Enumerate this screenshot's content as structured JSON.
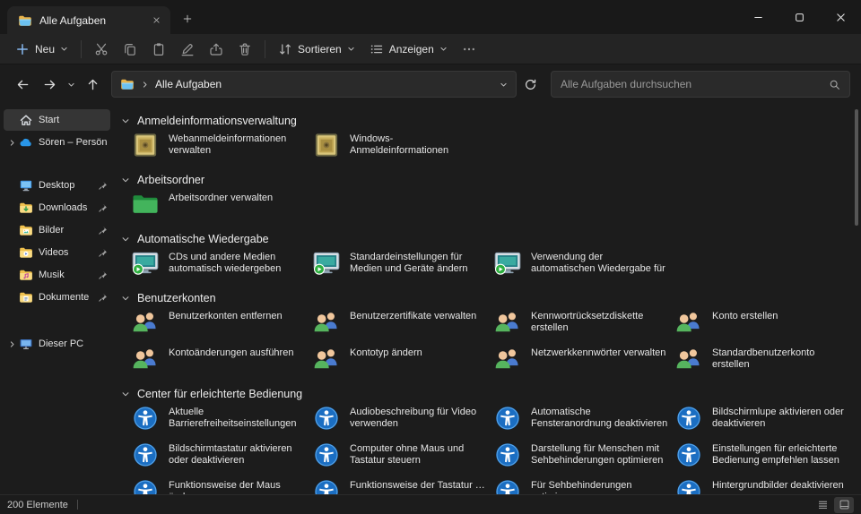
{
  "window": {
    "tab_title": "Alle Aufgaben"
  },
  "toolbar": {
    "new_label": "Neu",
    "sort_label": "Sortieren",
    "view_label": "Anzeigen"
  },
  "navbar": {
    "breadcrumb": "Alle Aufgaben",
    "search_placeholder": "Alle Aufgaben durchsuchen"
  },
  "sidebar": {
    "items": [
      {
        "id": "start",
        "label": "Start",
        "icon": "home",
        "selected": true
      },
      {
        "id": "soeren-persoenlich",
        "label": "Sören – Persönlich",
        "icon": "cloud",
        "expandable": true
      },
      {
        "id": "desktop",
        "label": "Desktop",
        "icon": "desktop",
        "pinned": true,
        "gap": "gap-sm"
      },
      {
        "id": "downloads",
        "label": "Downloads",
        "icon": "downloads",
        "pinned": true
      },
      {
        "id": "bilder",
        "label": "Bilder",
        "icon": "pictures",
        "pinned": true
      },
      {
        "id": "videos",
        "label": "Videos",
        "icon": "videos",
        "pinned": true
      },
      {
        "id": "musik",
        "label": "Musik",
        "icon": "music",
        "pinned": true
      },
      {
        "id": "dokumente",
        "label": "Dokumente",
        "icon": "documents",
        "pinned": true
      },
      {
        "id": "dieser-pc",
        "label": "Dieser PC",
        "icon": "pc",
        "expandable": true,
        "gap": "gap-lg"
      }
    ]
  },
  "content": {
    "groups": [
      {
        "title": "Anmeldeinformationsverwaltung",
        "icon": "vault",
        "items": [
          "Webanmeldeinformationen verwalten",
          "Windows-Anmeldeinformationen verwalten"
        ]
      },
      {
        "title": "Arbeitsordner",
        "icon": "workfolder",
        "items": [
          "Arbeitsordner verwalten"
        ]
      },
      {
        "title": "Automatische Wiedergabe",
        "icon": "autoplay",
        "items": [
          "CDs und andere Medien automatisch wiedergeben",
          "Standardeinstellungen für Medien und Geräte ändern",
          "Verwendung der automatischen Wiedergabe für alle Medien und …"
        ]
      },
      {
        "title": "Benutzerkonten",
        "icon": "users",
        "items": [
          "Benutzerkonten entfernen",
          "Benutzerzertifikate verwalten",
          "Kennwortrücksetzdiskette erstellen",
          "Konto erstellen",
          "Kontoänderungen ausführen",
          "Kontotyp ändern",
          "Netzwerkkennwörter verwalten",
          "Standardbenutzerkonto erstellen"
        ]
      },
      {
        "title": "Center für erleichterte Bedienung",
        "icon": "accessibility",
        "items": [
          "Aktuelle Barrierefreiheitseinstellungen anzei…",
          "Audiobeschreibung für Video verwenden",
          "Automatische Fensteranordnung deaktivieren",
          "Bildschirmlupe aktivieren oder deaktivieren",
          "Bildschirmtastatur aktivieren oder deaktivieren",
          "Computer ohne Maus und Tastatur steuern",
          "Darstellung für Menschen mit Sehbehinderungen optimieren",
          "Einstellungen für erleichterte Bedienung empfehlen lassen",
          "Funktionsweise der Maus änd…",
          "Funktionsweise der Tastatur …",
          "Für Sehbehinderungen optimi…",
          "Hintergrundbilder deaktivieren"
        ]
      }
    ]
  },
  "statusbar": {
    "items_count": "200 Elemente"
  },
  "colors": {
    "selection": "#353535",
    "accessibility_icon": "#1b6ec2",
    "autoplay_green": "#2daf3f",
    "folder_yellow": "#f0c14e"
  }
}
